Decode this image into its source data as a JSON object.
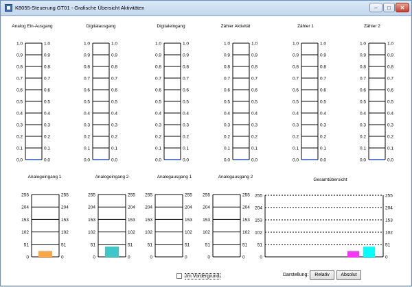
{
  "window": {
    "title": "K8055-Steuerung GT01 - Grafische Übersicht Aktivitäten",
    "minimize": "–",
    "maximize": "□",
    "close": "✕",
    "app_icon": "app-icon"
  },
  "top_row": {
    "ticks": [
      "0.0",
      "0.1",
      "0.2",
      "0.3",
      "0.4",
      "0.5",
      "0.6",
      "0.7",
      "0.8",
      "0.9",
      "1.0"
    ],
    "gauges": [
      {
        "title": "Analog Ein-Ausgang",
        "value": 0.0
      },
      {
        "title": "Digitalausgang",
        "value": 0.0
      },
      {
        "title": "Digitaleingang",
        "value": 0.0
      },
      {
        "title": "Zähler Aktivität",
        "value": 0.0
      },
      {
        "title": "Zähler 1",
        "value": 0.0
      },
      {
        "title": "Zähler 2",
        "value": 0.0
      }
    ]
  },
  "bottom_row": {
    "ticks": [
      "0",
      "51",
      "102",
      "153",
      "204",
      "255"
    ],
    "gauges": [
      {
        "title": "Analogeingang 1",
        "value": 24,
        "color": "#ffa640"
      },
      {
        "title": "Analogeingang 2",
        "value": 42,
        "color": "#3ec6c9"
      },
      {
        "title": "Analogausgang 1",
        "value": 0,
        "color": "#ffa640"
      },
      {
        "title": "Analogausgang 2",
        "value": 0,
        "color": "#ffa640"
      }
    ]
  },
  "chart_data": {
    "type": "bar",
    "title": "Gesamtübersicht",
    "ylim": [
      0,
      255
    ],
    "yticks": [
      "0",
      "51",
      "102",
      "153",
      "204",
      "255"
    ],
    "grid": true,
    "series": [
      {
        "values": [
          24
        ],
        "color": "#ff33ff"
      },
      {
        "values": [
          42
        ],
        "color": "#00ffff"
      }
    ]
  },
  "controls": {
    "foreground_checkbox": {
      "label": "Im Vordergrund",
      "checked": false
    },
    "display_label": "Darstellung:",
    "relative_button": "Relativ",
    "absolute_button": "Absolut"
  }
}
